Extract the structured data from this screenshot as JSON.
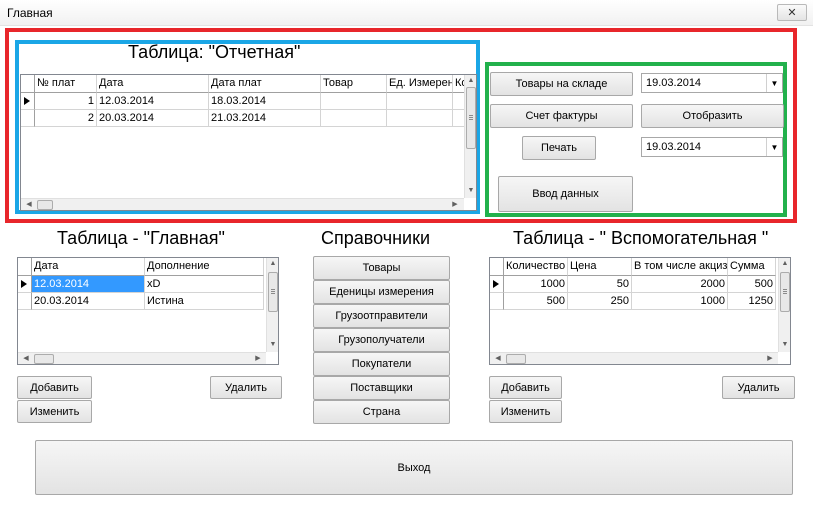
{
  "window": {
    "title": "Главная",
    "close_glyph": "✕"
  },
  "report_table": {
    "heading": "Таблица: \"Отчетная\"",
    "columns": [
      "№ плат",
      "Дата",
      "Дата плат",
      "Товар",
      "Ед. Измерен",
      "Ко"
    ],
    "rows": [
      [
        "1",
        "12.03.2014",
        "18.03.2014",
        "",
        "",
        ""
      ],
      [
        "2",
        "20.03.2014",
        "21.03.2014",
        "",
        "",
        ""
      ]
    ]
  },
  "actions": {
    "goods_in_stock": "Товары на складе",
    "invoice": "Счет фактуры",
    "print": "Печать",
    "data_entry": "Ввод данных",
    "display": "Отобразить",
    "date_from": "19.03.2014",
    "date_to": "19.03.2014"
  },
  "main_table": {
    "heading": "Таблица - \"Главная\"",
    "columns": [
      "Дата",
      "Дополнение"
    ],
    "rows": [
      [
        "12.03.2014",
        "xD"
      ],
      [
        "20.03.2014",
        "Истина"
      ]
    ],
    "add": "Добавить",
    "edit": "Изменить",
    "delete": "Удалить"
  },
  "references": {
    "heading": "Справочники",
    "items": [
      "Товары",
      "Еденицы измерения",
      "Грузоотправители",
      "Грузополучатели",
      "Покупатели",
      "Поставщики",
      "Страна"
    ]
  },
  "aux_table": {
    "heading": "Таблица - \" Вспомогательная \"",
    "columns": [
      "Количество",
      "Цена",
      "В том числе акциз",
      "Сумма"
    ],
    "rows": [
      [
        "1000",
        "50",
        "2000",
        "500"
      ],
      [
        "500",
        "250",
        "1000",
        "1250"
      ]
    ],
    "add": "Добавить",
    "edit": "Изменить",
    "delete": "Удалить"
  },
  "exit": "Выход",
  "colors": {
    "red_box": "#e8262b",
    "blue_box": "#1aa6e6",
    "green_box": "#22b14c",
    "selection": "#3399ff"
  }
}
